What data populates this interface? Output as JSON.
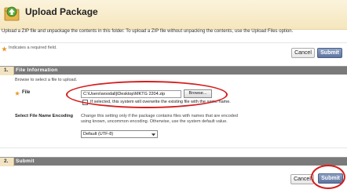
{
  "header": {
    "title": "Upload Package",
    "instructions": "Upload a ZIP file and unpackage the contents in this folder. To upload a ZIP file without unpacking the contents, use the Upload Files option."
  },
  "required_note": "Indicates a required field.",
  "buttons": {
    "cancel_label": "Cancel",
    "submit_label": "Submit"
  },
  "section1": {
    "number": "1.",
    "title": "File Information",
    "subtitle": "Browse to select a file to upload.",
    "file_label": "File",
    "file_value": "C:\\Users\\woodallj\\Desktop\\MKTG 2204.zip",
    "browse_label": "Browse...",
    "overwrite_label": "If selected, this system will overwrite the existing file with the same name.",
    "encoding_label": "Select File Name Encoding",
    "encoding_description": "Change this setting only if the package contains files with names that are encoded using known, uncommon encoding. Otherwise, use the system default value.",
    "encoding_value": "Default (UTF-8)"
  },
  "section2": {
    "number": "2.",
    "title": "Submit"
  },
  "colors": {
    "header_bg": "#f5e6bd",
    "section_bar": "#7a7a7a",
    "submit_btn": "#5d749e",
    "annotation": "#d51d1d",
    "required_star": "#e8941f"
  },
  "icons": [
    "folder-upload-icon",
    "required-star-icon",
    "dropdown-arrow-icon"
  ]
}
